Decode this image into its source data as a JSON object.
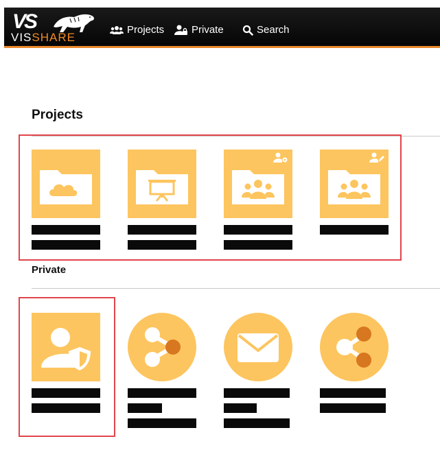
{
  "brand": {
    "logo_letters": "VS",
    "logo_word_a": "VIS",
    "logo_word_b": "SHARE"
  },
  "nav": [
    {
      "label": "Projects",
      "icon": "users-icon"
    },
    {
      "label": "Private",
      "icon": "user-lock-icon"
    },
    {
      "label": "Search",
      "icon": "search-icon"
    }
  ],
  "sections": {
    "projects": {
      "title": "Projects"
    },
    "private": {
      "title": "Private"
    }
  },
  "colors": {
    "accent": "#f08a24",
    "tile": "#fdc55f",
    "tile_dark": "#d7771f",
    "highlight": "#e0444a"
  }
}
